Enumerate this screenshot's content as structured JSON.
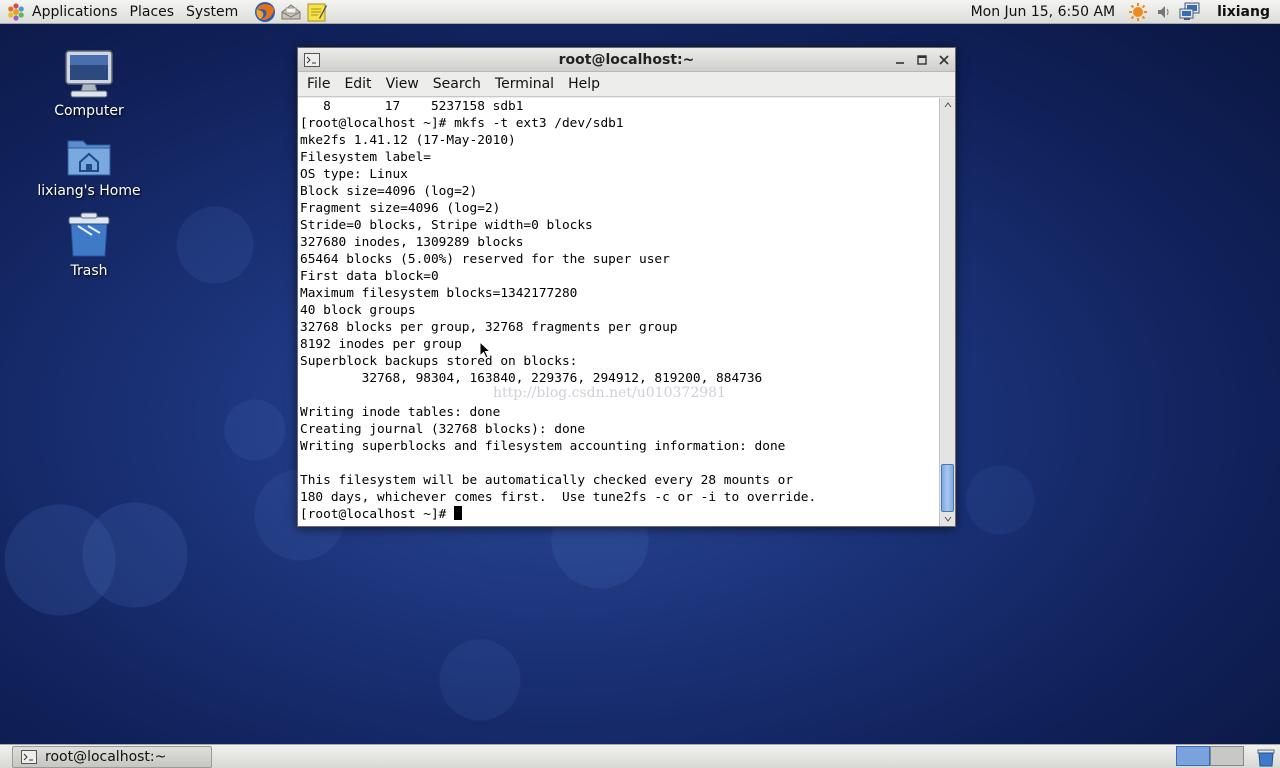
{
  "top_panel": {
    "menus": [
      "Applications",
      "Places",
      "System"
    ],
    "launchers": [
      "firefox-icon",
      "mail-icon",
      "notes-icon"
    ],
    "clock": "Mon Jun 15,  6:50 AM",
    "user": "lixiang"
  },
  "desktop": {
    "icons": [
      {
        "label": "Computer",
        "icon": "computer-icon"
      },
      {
        "label": "lixiang's Home",
        "icon": "home-folder-icon"
      },
      {
        "label": "Trash",
        "icon": "trash-icon"
      }
    ]
  },
  "terminal": {
    "title": "root@localhost:~",
    "menu": [
      "File",
      "Edit",
      "View",
      "Search",
      "Terminal",
      "Help"
    ],
    "lines": [
      "   8       17    5237158 sdb1",
      "[root@localhost ~]# mkfs -t ext3 /dev/sdb1",
      "mke2fs 1.41.12 (17-May-2010)",
      "Filesystem label=",
      "OS type: Linux",
      "Block size=4096 (log=2)",
      "Fragment size=4096 (log=2)",
      "Stride=0 blocks, Stripe width=0 blocks",
      "327680 inodes, 1309289 blocks",
      "65464 blocks (5.00%) reserved for the super user",
      "First data block=0",
      "Maximum filesystem blocks=1342177280",
      "40 block groups",
      "32768 blocks per group, 32768 fragments per group",
      "8192 inodes per group",
      "Superblock backups stored on blocks:",
      "        32768, 98304, 163840, 229376, 294912, 819200, 884736",
      "",
      "Writing inode tables: done",
      "Creating journal (32768 blocks): done",
      "Writing superblocks and filesystem accounting information: done",
      "",
      "This filesystem will be automatically checked every 28 mounts or",
      "180 days, whichever comes first.  Use tune2fs -c or -i to override."
    ],
    "prompt": "[root@localhost ~]# ",
    "watermark": "http://blog.csdn.net/u010372981",
    "scroll_position": 1.0
  },
  "bottom_panel": {
    "task": "root@localhost:~",
    "workspaces": 2,
    "active_workspace": 1
  },
  "colors": {
    "desktop_bg": "#1b3278",
    "scroll_thumb": "#7fa8e0",
    "workspace_active": "#7aa3dd"
  }
}
